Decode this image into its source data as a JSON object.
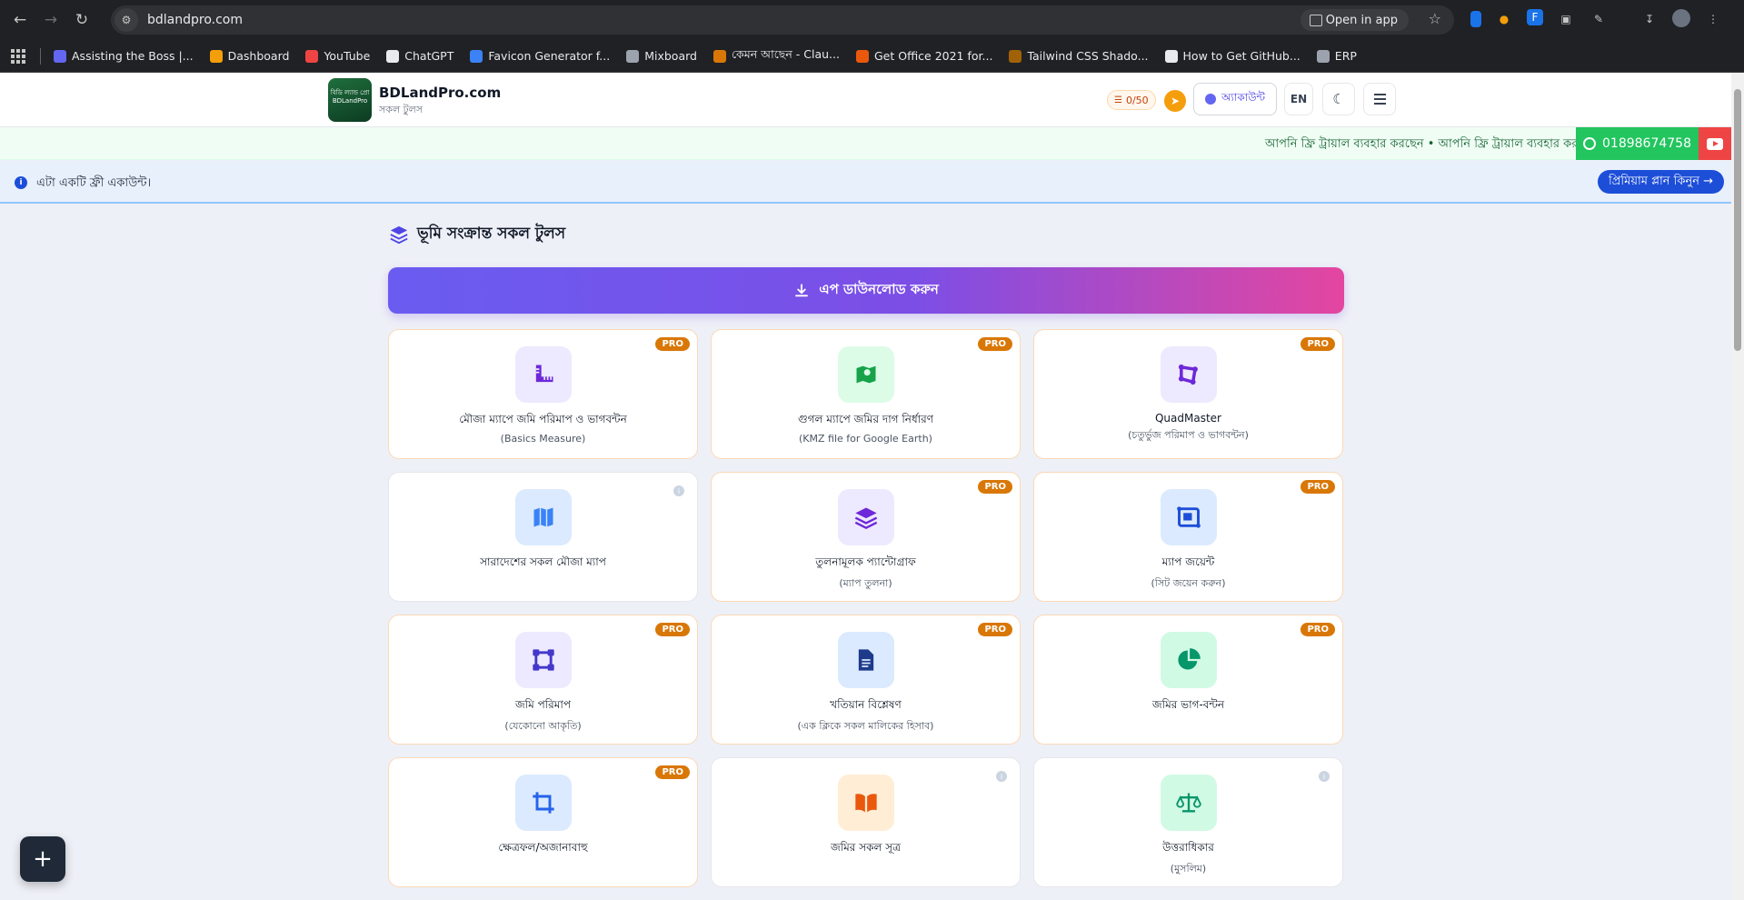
{
  "browser": {
    "url": "bdlandpro.com",
    "open_in_app": "Open in app",
    "bookmarks": [
      {
        "label": "Assisting the Boss |...",
        "color": "#6366f1"
      },
      {
        "label": "Dashboard",
        "color": "#f59e0b"
      },
      {
        "label": "YouTube",
        "color": "#ef4444"
      },
      {
        "label": "ChatGPT",
        "color": "#e8eaed"
      },
      {
        "label": "Favicon Generator f...",
        "color": "#3b82f6"
      },
      {
        "label": "Mixboard",
        "color": "#9ca3af"
      },
      {
        "label": "কেমন আছেন - Clau...",
        "color": "#d97706"
      },
      {
        "label": "Get Office 2021 for...",
        "color": "#ea580c"
      },
      {
        "label": "Tailwind CSS Shado...",
        "color": "#a16207"
      },
      {
        "label": "How to Get GitHub...",
        "color": "#e8eaed"
      },
      {
        "label": "ERP",
        "color": "#9ca3af"
      }
    ]
  },
  "header": {
    "logo_text": "বিডি ল্যান্ড প্রো BDLandPro",
    "brand_name": "BDLandPro.com",
    "brand_sub": "সকল টুলস",
    "credits": "0/50",
    "account_label": "অ্যাকাউন্ট",
    "lang_label": "EN"
  },
  "ticker": {
    "text": "আপনি ফ্রি ট্রায়াল ব্যবহার করছেন • আপনি ফ্রি ট্রায়াল ব্যবহার করছেন •",
    "phone": "01898674758"
  },
  "notice": {
    "text": "এটা একটি ফ্রী একাউন্ট।",
    "premium_label": "প্রিমিয়াম প্লান কিনুন →"
  },
  "main": {
    "section_title": "ভূমি সংক্রান্ত সকল টুলস",
    "download_label": "এপ ডাউনলোড করুন",
    "tools": [
      {
        "title": "মৌজা ম্যাপে জমি পরিমাপ ও ভাগবন্টন",
        "subtitle": "(Basics Measure)",
        "badge": "PRO",
        "icon": "ruler-icon",
        "tile_bg": "#ede9fe",
        "icon_color": "#6d28d9"
      },
      {
        "title": "গুগল ম্যাপে জমির দাগ নির্ধারণ",
        "subtitle": "(KMZ file for Google Earth)",
        "badge": "PRO",
        "icon": "map-pin-icon",
        "tile_bg": "#dcfce7",
        "icon_color": "#16a34a"
      },
      {
        "title": "QuadMaster",
        "subtitle": "(চতুর্ভুজ পরিমাপ ও ভাগবন্টন)",
        "badge": "PRO",
        "icon": "quad-icon",
        "tile_bg": "#ede9fe",
        "icon_color": "#6d28d9"
      },
      {
        "title": "সারাদেশের সকল মৌজা ম্যাপ",
        "subtitle": "",
        "badge": "",
        "icon": "folded-map-icon",
        "tile_bg": "#dbeafe",
        "icon_color": "#3b82f6"
      },
      {
        "title": "তুলনামূলক প্যান্টোগ্রাফ",
        "subtitle": "(ম্যাপ তুলনা)",
        "badge": "PRO",
        "icon": "layers-icon",
        "tile_bg": "#ede9fe",
        "icon_color": "#6d28d9"
      },
      {
        "title": "ম্যাপ জয়েন্ট",
        "subtitle": "(সিট জয়েন করুন)",
        "badge": "PRO",
        "icon": "map-join-icon",
        "tile_bg": "#dbeafe",
        "icon_color": "#1d4ed8"
      },
      {
        "title": "জমি পরিমাপ",
        "subtitle": "(যেকোনো আকৃতি)",
        "badge": "PRO",
        "icon": "vector-square-icon",
        "tile_bg": "#ede9fe",
        "icon_color": "#4338ca"
      },
      {
        "title": "খতিয়ান বিশ্লেষণ",
        "subtitle": "(এক ক্লিকে সকল মালিকের হিসাব)",
        "badge": "PRO",
        "icon": "document-icon",
        "tile_bg": "#dbeafe",
        "icon_color": "#1e3a8a"
      },
      {
        "title": "জমির ভাগ-বন্টন",
        "subtitle": "",
        "badge": "PRO",
        "icon": "pie-chart-icon",
        "tile_bg": "#d1fae5",
        "icon_color": "#059669"
      },
      {
        "title": "ক্ষেত্রফল/অজানাবাহু",
        "subtitle": "",
        "badge": "PRO",
        "icon": "crop-icon",
        "tile_bg": "#dbeafe",
        "icon_color": "#2563eb"
      },
      {
        "title": "জমির সকল সূত্র",
        "subtitle": "",
        "badge": "",
        "icon": "open-book-icon",
        "tile_bg": "#ffedd5",
        "icon_color": "#ea580c"
      },
      {
        "title": "উত্তরাধিকার",
        "subtitle": "(মুসলিম)",
        "badge": "",
        "icon": "scales-icon",
        "tile_bg": "#d1fae5",
        "icon_color": "#059669"
      }
    ]
  }
}
